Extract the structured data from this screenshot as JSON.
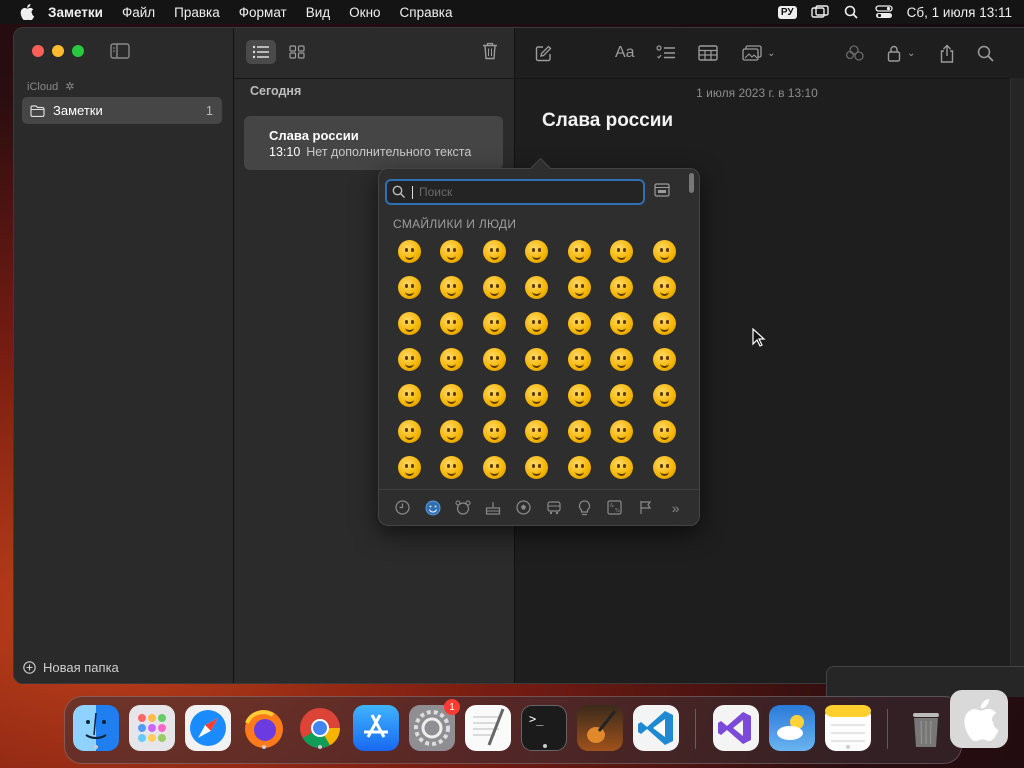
{
  "menubar": {
    "app_name": "Заметки",
    "items": [
      "Файл",
      "Правка",
      "Формат",
      "Вид",
      "Окно",
      "Справка"
    ],
    "input_source": "РУ",
    "datetime": "Сб, 1 июля  13:11"
  },
  "sidebar": {
    "account_label": "iCloud",
    "folders": [
      {
        "label": "Заметки",
        "count": "1"
      }
    ],
    "new_folder_label": "Новая папка"
  },
  "note_list": {
    "section_header": "Сегодня",
    "notes": [
      {
        "title": "Слава россии",
        "time": "13:10",
        "preview": "Нет дополнительного текста"
      }
    ]
  },
  "editor": {
    "date_line": "1 июля 2023 г. в 13:10",
    "title": "Слава россии"
  },
  "emoji_picker": {
    "search_placeholder": "Поиск",
    "category_header": "СМАЙЛИКИ И ЛЮДИ",
    "emojis": [
      "😀",
      "😃",
      "😄",
      "😁",
      "😆",
      "🥹",
      "😅",
      "😂",
      "🤣",
      "🥲",
      "☺️",
      "😊",
      "😇",
      "🙂",
      "🙃",
      "😉",
      "😌",
      "😍",
      "🥰",
      "😘",
      "😗",
      "😙",
      "😚",
      "😋",
      "😛",
      "😝",
      "😜",
      "🤪",
      "🤨",
      "🧐",
      "🤓",
      "😎",
      "🥸",
      "🤩",
      "🥳",
      "😏",
      "😒",
      "😞",
      "😔",
      "😟",
      "😕",
      "🙁",
      "☹️",
      "😣",
      "😖",
      "😫",
      "😩",
      "🥺",
      "😢"
    ],
    "categories": [
      "clock-icon",
      "smiley-icon",
      "bear-icon",
      "food-icon",
      "ball-icon",
      "car-icon",
      "bulb-icon",
      "symbols-icon",
      "flag-icon",
      "more-icon"
    ]
  },
  "dock": {
    "apps": [
      "Finder",
      "Launchpad",
      "Safari",
      "Firefox",
      "Chrome",
      "App Store",
      "System Settings",
      "TextEdit",
      "Terminal",
      "GarageBand",
      "VS Code",
      "Visual Studio",
      "Weather",
      "Notes",
      "Trash"
    ],
    "settings_badge": "1"
  },
  "colors": {
    "accent": "#2f6fb4",
    "window_bg": "#1e1e1e",
    "sidebar_bg": "#2a2a2a"
  }
}
